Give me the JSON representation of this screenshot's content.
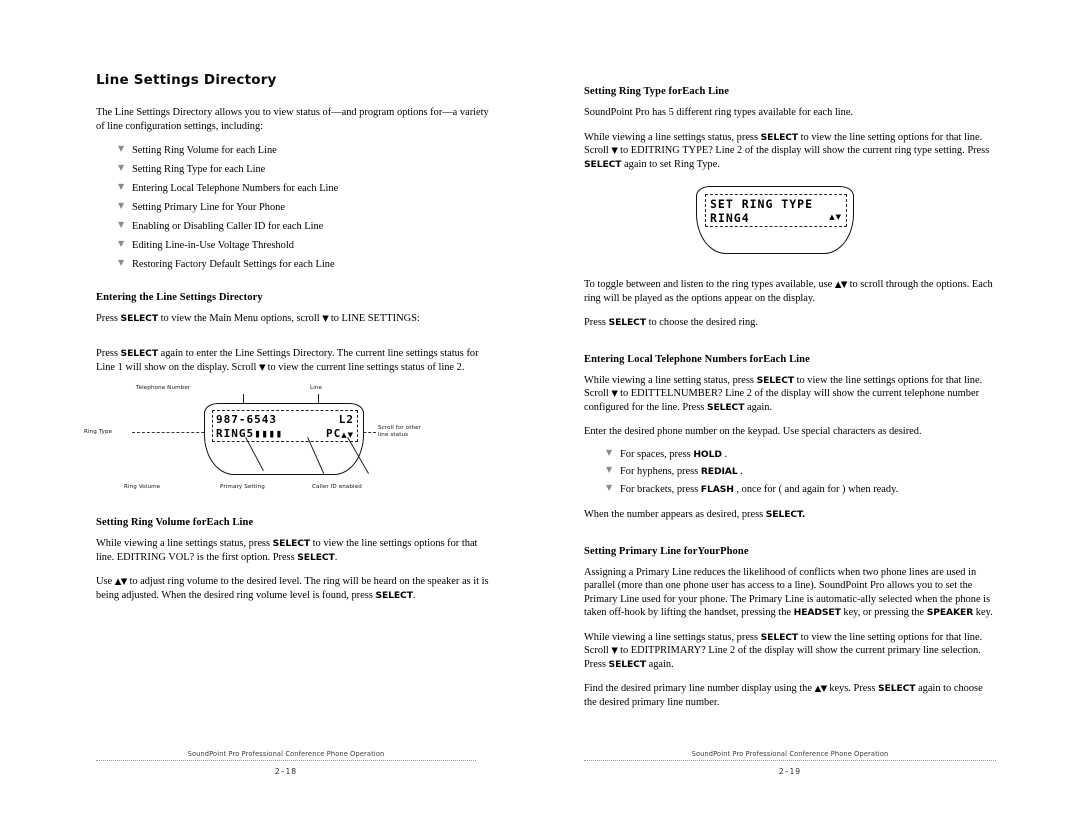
{
  "document": {
    "title": "SoundPoint Pro Professional Conference Phone Operation"
  },
  "left_page": {
    "chapter_heading": "Line Settings Directory",
    "intro": "The Line Settings Directory allows you to view status of—and program options for—a variety of line configuration settings, including:",
    "feature_list": [
      "Setting Ring Volume for each Line",
      "Setting Ring Type for each Line",
      "Entering Local Telephone Numbers for each Line",
      "Setting Primary Line for Your Phone",
      "Enabling or Disabling Caller ID for each Line",
      "Editing Line-in-Use Voltage Threshold",
      "Restoring Factory Default Settings for each Line"
    ],
    "entering_section": {
      "heading": "Entering the Line Settings Directory",
      "para1_a": "Press ",
      "para1_key": "SELECT",
      "para1_b": " to view the Main Menu options, scroll ",
      "para1_arrow": "▼",
      "para1_c": " to LINE SETTINGS:",
      "para2_a": "Press ",
      "para2_key": "SELECT",
      "para2_b": " again to enter the Line Settings Directory. The current line settings status for Line 1 will show on the display. Scroll ",
      "para2_arrow": "▼",
      "para2_c": " to view the current line settings status of line 2."
    },
    "figure_line_status": {
      "lcd_line1_left": "987-6543",
      "lcd_line1_right": "L2",
      "lcd_line2_left": "RING5",
      "lcd_line2_bars": "▮▮▮▮",
      "lcd_line2_right": "PC",
      "lcd_scroll_glyph": "▲▼",
      "callout_telephone_number": "Telephone Number",
      "callout_line": "Line",
      "callout_ring_type": "Ring Type",
      "callout_scroll": "Scroll for other\nline status",
      "callout_ring_volume": "Ring Volume",
      "callout_primary_setting": "Primary Setting",
      "callout_caller_id": "Caller ID enabled"
    },
    "ring_volume_section": {
      "heading": "Setting Ring Volume forEach Line",
      "para1_a": "While viewing a line settings status, press ",
      "para1_key1": "SELECT",
      "para1_b": " to view the line settings options for that line. EDITRING VOL? is the first option. Press ",
      "para1_key2": "SELECT",
      "para1_c": ".",
      "para2_a": "Use ",
      "para2_arrows": "▲▼",
      "para2_b": " to adjust ring volume to the desired level. The ring will be heard on the speaker as it is being adjusted. When the desired ring volume level is found, press ",
      "para2_key": "SELECT",
      "para2_c": "."
    },
    "footer_page_number": "2–18"
  },
  "right_page": {
    "ring_type_section": {
      "heading": "Setting Ring Type forEach Line",
      "para1": "SoundPoint Pro has 5 different ring types available for each line.",
      "para2_a": "While viewing a line settings status, press ",
      "para2_key1": "SELECT",
      "para2_b": " to view the line setting options for that line. Scroll ",
      "para2_arrow": "▼",
      "para2_c": " to EDITRING TYPE? Line 2 of the display will show the current ring type setting. Press ",
      "para2_key2": "SELECT",
      "para2_d": " again to set Ring Type.",
      "para3_a": "To toggle between and listen to the ring types available, use ",
      "para3_arrows": "▲▼",
      "para3_b": " to scroll through the options. Each ring will be played as the options appear on the display.",
      "para4_a": "Press ",
      "para4_key": "SELECT",
      "para4_b": " to choose the desired ring."
    },
    "figure_set_ring_type": {
      "lcd_line1": "SET RING TYPE",
      "lcd_line2": "RING4",
      "lcd_scroll_glyph": "▲▼"
    },
    "telephone_numbers_section": {
      "heading": "Entering Local Telephone Numbers forEach Line",
      "para1_a": "While viewing a line setting status, press ",
      "para1_key1": "SELECT",
      "para1_b": " to view the line settings options for that line. Scroll ",
      "para1_arrow": "▼",
      "para1_c": " to EDITTELNUMBER? Line 2 of the display will show the current telephone number configured for the line. Press ",
      "para1_key2": "SELECT",
      "para1_d": " again.",
      "para2": "Enter the desired phone number on the keypad. Use special characters as desired.",
      "key_items": [
        {
          "prefix": "For spaces, press ",
          "key": "HOLD",
          "suffix": " ."
        },
        {
          "prefix": "For hyphens, press ",
          "key": "REDIAL",
          "suffix": " ."
        },
        {
          "prefix": "For brackets, press ",
          "key": "FLASH",
          "suffix": " , once for ( and again for ) when ready."
        }
      ],
      "para3_a": "When the number appears as desired, press ",
      "para3_key": "SELECT.",
      "para3_b": ""
    },
    "primary_line_section": {
      "heading": "Setting Primary Line forYourPhone",
      "para1_a": "Assigning a Primary Line reduces the likelihood of conflicts when two phone lines are used in parallel (more than one phone user has access to a line). SoundPoint Pro allows you to set the Primary Line used for your phone. The Primary Line is automatic-ally selected when the phone is taken off-hook by lifting the handset, pressing the ",
      "para1_key1": "HEADSET",
      "para1_b": " key, or pressing the ",
      "para1_key2": "SPEAKER",
      "para1_c": "  key.",
      "para2_a": "While viewing a line settings status, press ",
      "para2_key1": "SELECT",
      "para2_b": " to view the line setting options for that line. Scroll ",
      "para2_arrow": "▼",
      "para2_c": " to EDITPRIMARY? Line 2 of the display will show the current primary line selection. Press ",
      "para2_key2": "SELECT",
      "para2_d": " again.",
      "para3_a": "Find the desired primary line number display using the ",
      "para3_arrows": "▲▼",
      "para3_b": " keys. Press ",
      "para3_key": "SELECT",
      "para3_c": " again to choose the desired primary line number."
    },
    "footer_page_number": "2–19"
  }
}
